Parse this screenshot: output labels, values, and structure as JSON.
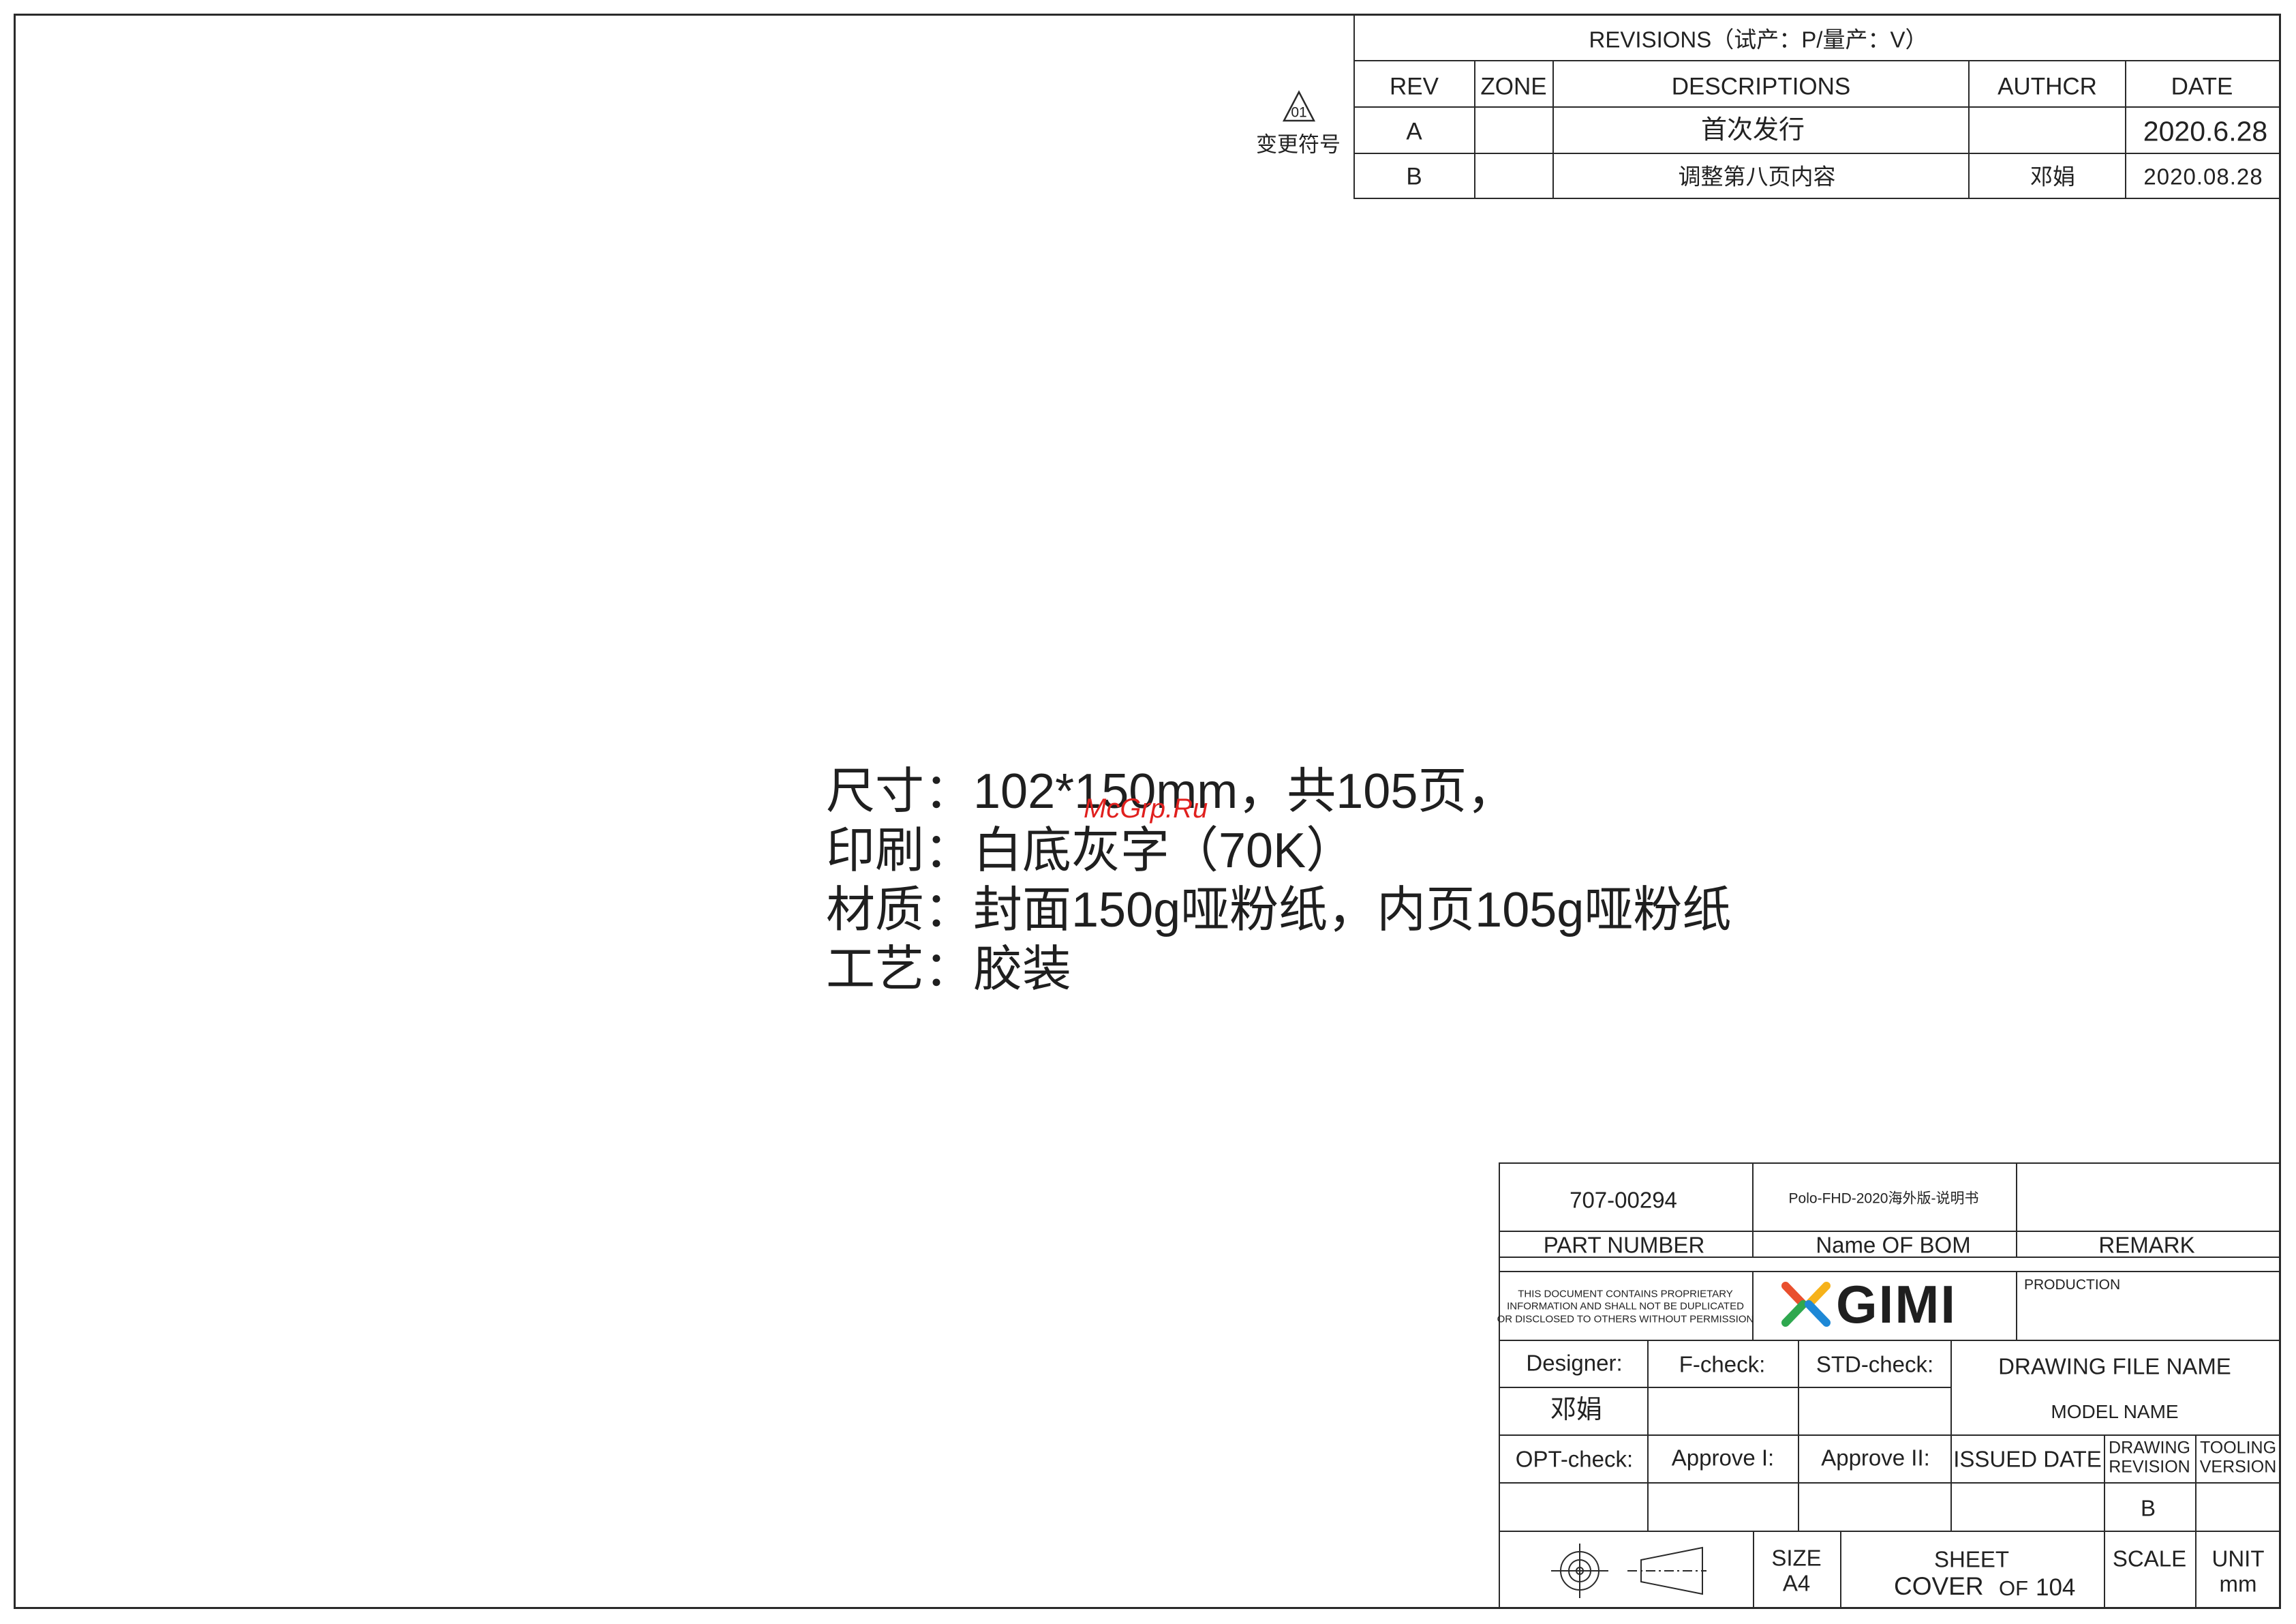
{
  "revisions": {
    "title": "REVISIONS（试产：P/量产：V）",
    "columns": [
      "REV",
      "ZONE",
      "DESCRIPTIONS",
      "AUTHCR",
      "DATE"
    ],
    "rows": [
      {
        "rev": "A",
        "zone": "",
        "description": "首次发行",
        "author": "",
        "date": "2020.6.28"
      },
      {
        "rev": "B",
        "zone": "",
        "description": "调整第八页内容",
        "author": "邓娟",
        "date": "2020.08.28"
      }
    ]
  },
  "change_symbol": {
    "number": "01",
    "label": "变更符号"
  },
  "notes": [
    "尺寸：102*150mm，共105页，",
    "印刷：白底灰字（70K）",
    "材质：封面150g哑粉纸，内页105g哑粉纸",
    "工艺：胶装"
  ],
  "watermark": "McGrp.Ru",
  "title_block": {
    "part_number_value": "707-00294",
    "bom_name_value": "Polo-FHD-2020海外版-说明书",
    "remark_value": "",
    "part_number_label": "PART NUMBER",
    "bom_name_label": "Name OF BOM",
    "remark_label": "REMARK",
    "proprietary": [
      "THIS DOCUMENT CONTAINS PROPRIETARY",
      "INFORMATION AND SHALL NOT BE DUPLICATED",
      "OR DISCLOSED TO OTHERS WITHOUT PERMISSION"
    ],
    "logo_text": "GIMI",
    "production_label": "PRODUCTION",
    "designer_label": "Designer:",
    "designer_value": "邓娟",
    "fcheck_label": "F-check:",
    "stdcheck_label": "STD-check:",
    "drawing_file_name_label": "DRAWING FILE NAME",
    "model_name_label": "MODEL NAME",
    "optcheck_label": "OPT-check:",
    "approve1_label": "Approve I:",
    "approve2_label": "Approve II:",
    "issued_date_label": "ISSUED DATE",
    "drawing_revision_label_1": "DRAWING",
    "drawing_revision_label_2": "REVISION",
    "tooling_version_label_1": "TOOLING",
    "tooling_version_label_2": "VERSION",
    "drawing_revision_value": "B",
    "size_label": "SIZE",
    "size_value": "A4",
    "sheet_label": "SHEET",
    "sheet_cover": "COVER",
    "sheet_of": "OF",
    "sheet_total": "104",
    "scale_label": "SCALE",
    "unit_label": "UNIT",
    "unit_value": "mm"
  },
  "colors": {
    "line": "#2a2a2a",
    "watermark": "#e0201e",
    "logo_x_colors": [
      "#e94f2e",
      "#f6b21a",
      "#2fa84f",
      "#1e88d6"
    ]
  }
}
